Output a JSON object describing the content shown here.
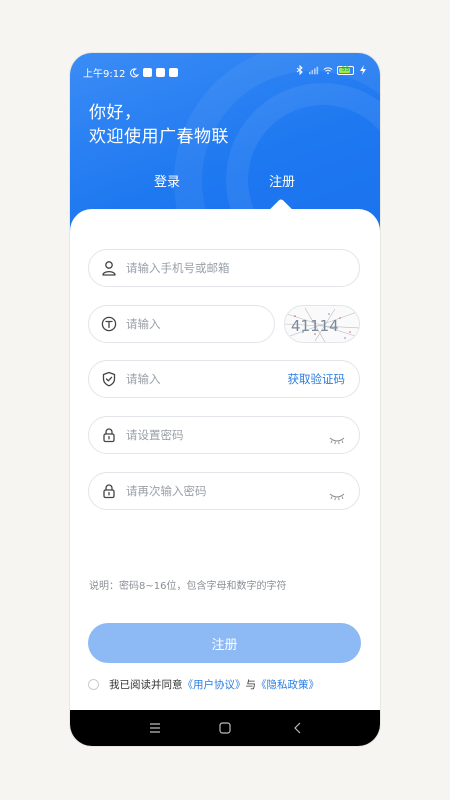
{
  "status_bar": {
    "time": "上午9:12",
    "battery_level": "55"
  },
  "header": {
    "greeting_line1": "你好，",
    "greeting_line2": "欢迎使用广春物联"
  },
  "tabs": [
    {
      "label": "登录",
      "active": false
    },
    {
      "label": "注册",
      "active": true
    }
  ],
  "form": {
    "account_placeholder": "请输入手机号或邮箱",
    "captcha_placeholder": "请输入",
    "captcha_text": "41114",
    "sms_code_placeholder": "请输入",
    "get_code_label": "获取验证码",
    "password_placeholder": "请设置密码",
    "confirm_password_placeholder": "请再次输入密码",
    "hint": "说明：密码8~16位，包含字母和数字的字符"
  },
  "register_button": "注册",
  "agreement": {
    "prefix": "我已阅读并同意",
    "user_agreement": "《用户协议》",
    "and": "与",
    "privacy_policy": "《隐私政策》"
  },
  "colors": {
    "brand_blue": "#1e78f0",
    "button_disabled": "#8db9f4",
    "link": "#2a7de1"
  },
  "icons": {
    "account": "person-icon",
    "captcha": "text-t-icon",
    "sms": "shield-check-icon",
    "password": "lock-icon",
    "eye": "eye-closed-icon"
  }
}
